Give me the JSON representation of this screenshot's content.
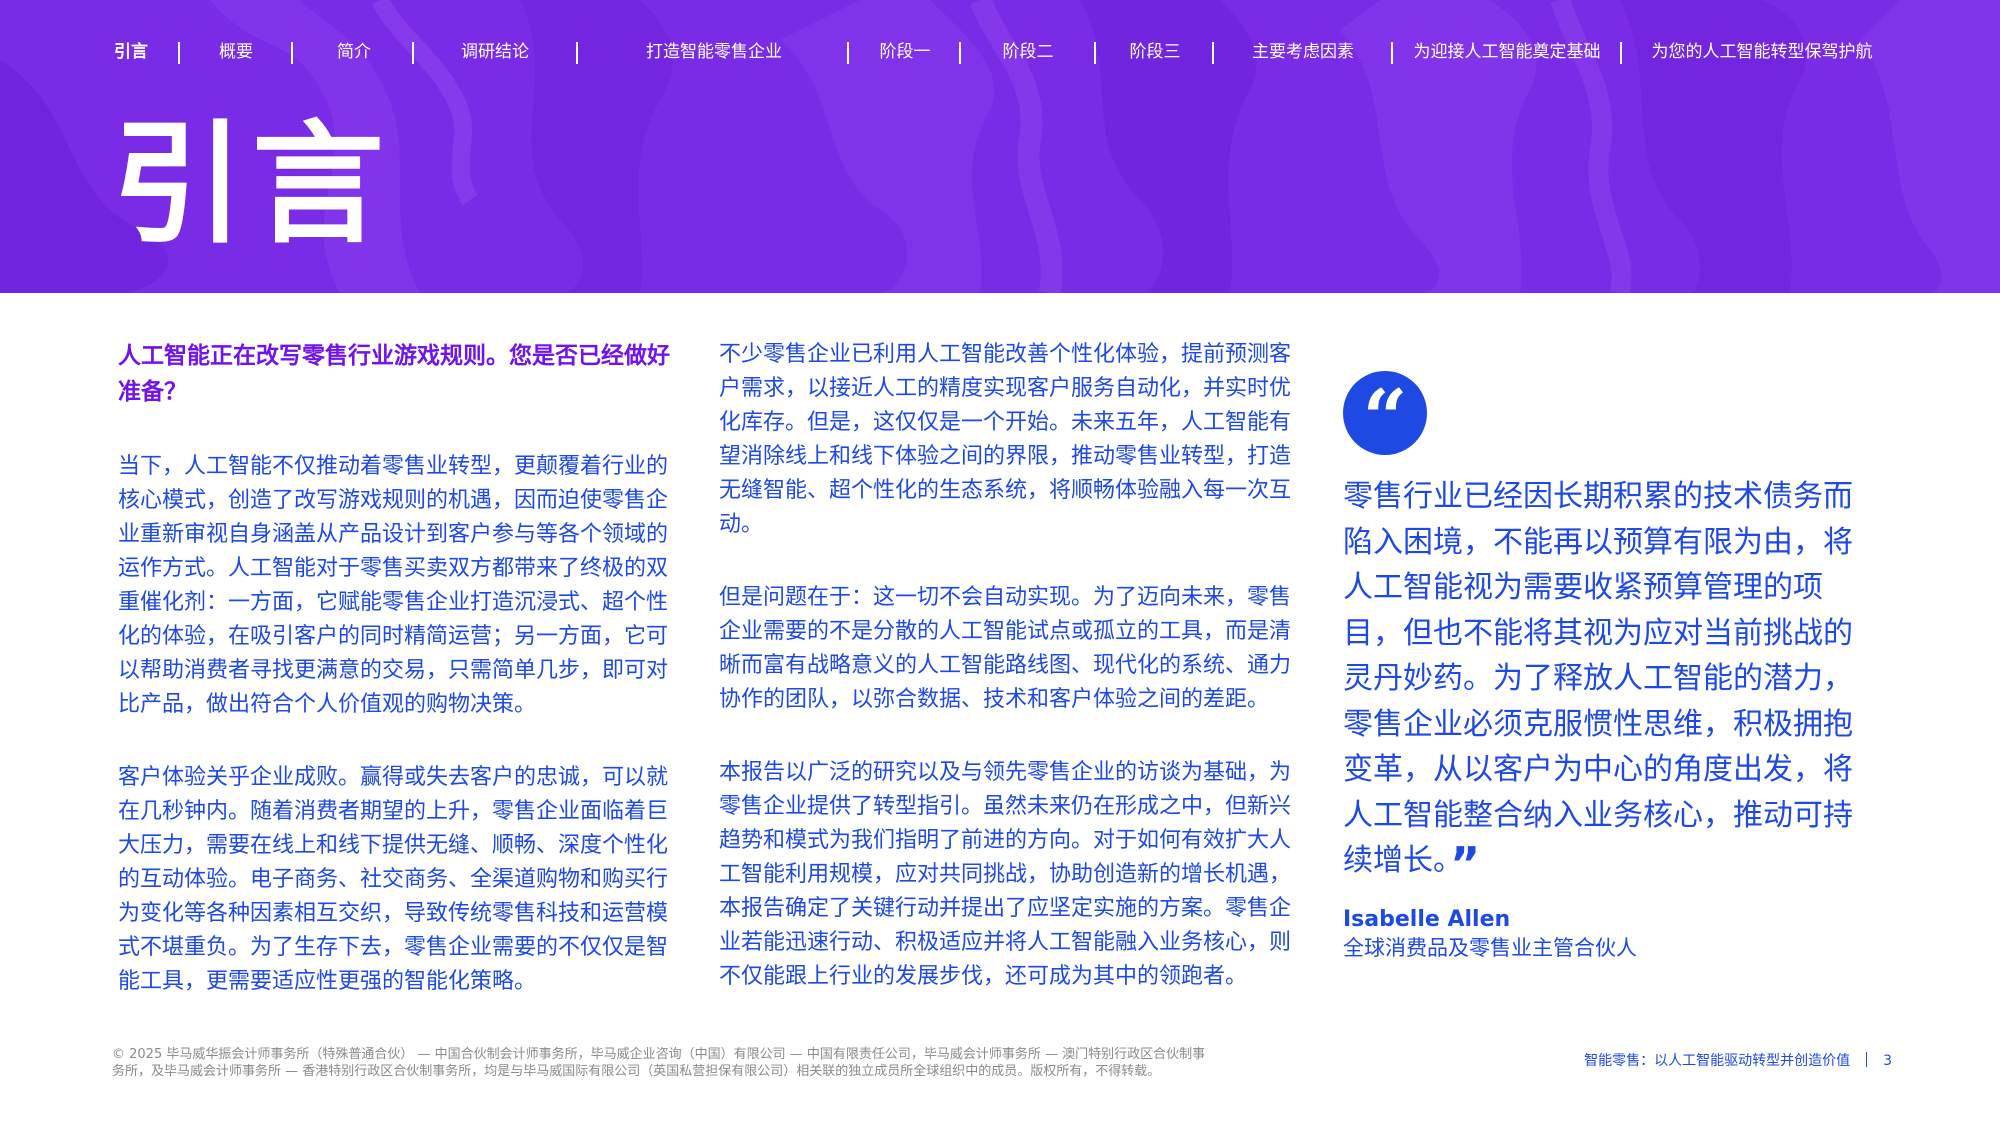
{
  "nav": {
    "items": [
      "引言",
      "概要",
      "简介",
      "调研结论",
      "打造智能零售企业",
      "阶段一",
      "阶段二",
      "阶段三",
      "主要考虑因素",
      "为迎接人工智能奠定基础",
      "为您的人工智能转型保驾护航"
    ]
  },
  "hero": {
    "title": "引言"
  },
  "col1": {
    "lead": "人工智能正在改写零售行业游戏规则。您是否已经做好准备？",
    "p1": "当下，人工智能不仅推动着零售业转型，更颠覆着行业的核心模式，创造了改写游戏规则的机遇，因而迫使零售企业重新审视自身涵盖从产品设计到客户参与等各个领域的运作方式。人工智能对于零售买卖双方都带来了终极的双重催化剂：一方面，它赋能零售企业打造沉浸式、超个性化的体验，在吸引客户的同时精简运营；另一方面，它可以帮助消费者寻找更满意的交易，只需简单几步，即可对比产品，做出符合个人价值观的购物决策。",
    "p2": "客户体验关乎企业成败。赢得或失去客户的忠诚，可以就在几秒钟内。随着消费者期望的上升，零售企业面临着巨大压力，需要在线上和线下提供无缝、顺畅、深度个性化的互动体验。电子商务、社交商务、全渠道购物和购买行为变化等各种因素相互交织，导致传统零售科技和运营模式不堪重负。为了生存下去，零售企业需要的不仅仅是智能工具，更需要适应性更强的智能化策略。"
  },
  "col2": {
    "p1": "不少零售企业已利用人工智能改善个性化体验，提前预测客户需求，以接近人工的精度实现客户服务自动化，并实时优化库存。但是，这仅仅是一个开始。未来五年，人工智能有望消除线上和线下体验之间的界限，推动零售业转型，打造无缝智能、超个性化的生态系统，将顺畅体验融入每一次互动。",
    "p2": "但是问题在于：这一切不会自动实现。为了迈向未来，零售企业需要的不是分散的人工智能试点或孤立的工具，而是清晰而富有战略意义的人工智能路线图、现代化的系统、通力协作的团队，以弥合数据、技术和客户体验之间的差距。",
    "p3": "本报告以广泛的研究以及与领先零售企业的访谈为基础，为零售企业提供了转型指引。虽然未来仍在形成之中，但新兴趋势和模式为我们指明了前进的方向。对于如何有效扩大人工智能利用规模，应对共同挑战，协助创造新的增长机遇，本报告确定了关键行动并提出了应坚定实施的方案。零售企业若能迅速行动、积极适应并将人工智能融入业务核心，则不仅能跟上行业的发展步伐，还可成为其中的领跑者。"
  },
  "quote": {
    "text": "零售行业已经因长期积累的技术债务而陷入困境，不能再以预算有限为由，将人工智能视为需要收紧预算管理的项目，但也不能将其视为应对当前挑战的灵丹妙药。为了释放人工智能的潜力，零售企业必须克服惯性思维，积极拥抱变革，从以客户为中心的角度出发，将人工智能整合纳入业务核心，推动可持续增长。",
    "open_mark": "“",
    "close_mark": "”",
    "author": "Isabelle Allen",
    "author_title": "全球消费品及零售业主管合伙人"
  },
  "footer": {
    "copyright": "© 2025 毕马威华振会计师事务所（特殊普通合伙） — 中国合伙制会计师事务所，毕马威企业咨询（中国）有限公司 — 中国有限责任公司，毕马威会计师事务所 — 澳门特别行政区合伙制事务所，及毕马威会计师事务所 — 香港特别行政区合伙制事务所，均是与毕马威国际有限公司（英国私营担保有限公司）相关联的独立成员所全球组织中的成员。版权所有，不得转载。",
    "report_title": "智能零售：以人工智能驱动转型并创造价值",
    "page_number": "3"
  },
  "colors": {
    "hero_purple": "#7a2be6",
    "hero_dark_purple": "#6a1fd6",
    "body_blue": "#1e49e2",
    "lead_purple": "#7213ea",
    "footer_gray": "#8a8a8a"
  }
}
